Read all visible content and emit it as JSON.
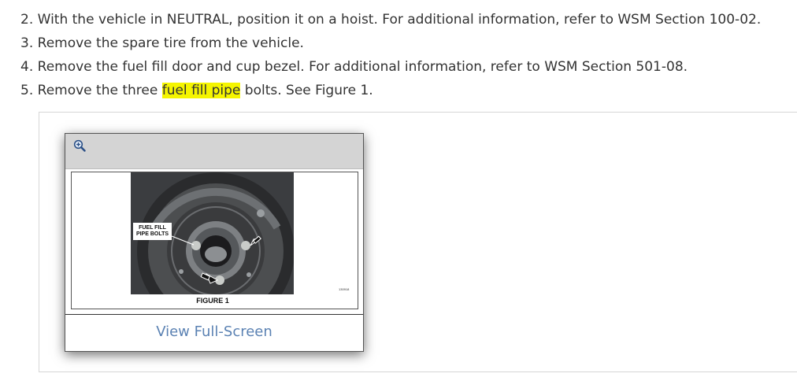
{
  "steps": [
    {
      "number": "2.",
      "text": "With the vehicle in NEUTRAL, position it on a hoist. For additional information, refer to WSM Section 100-02."
    },
    {
      "number": "3.",
      "text": "Remove the spare tire from the vehicle."
    },
    {
      "number": "4.",
      "text": "Remove the fuel fill door and cup bezel. For additional information, refer to WSM Section 501-08."
    },
    {
      "number": "5.",
      "text_before": "Remove the three",
      "highlight": "fuel fill pipe",
      "text_after": "bolts. See Figure 1."
    }
  ],
  "figure": {
    "callout_line1": "FUEL FILL",
    "callout_line2": "PIPE BOLTS",
    "caption": "FIGURE 1",
    "code": "130918",
    "icon": "zoom-in-icon"
  },
  "fullscreen_label": "View Full-Screen",
  "colors": {
    "highlight": "#f5f500",
    "link": "#5b82b3"
  }
}
